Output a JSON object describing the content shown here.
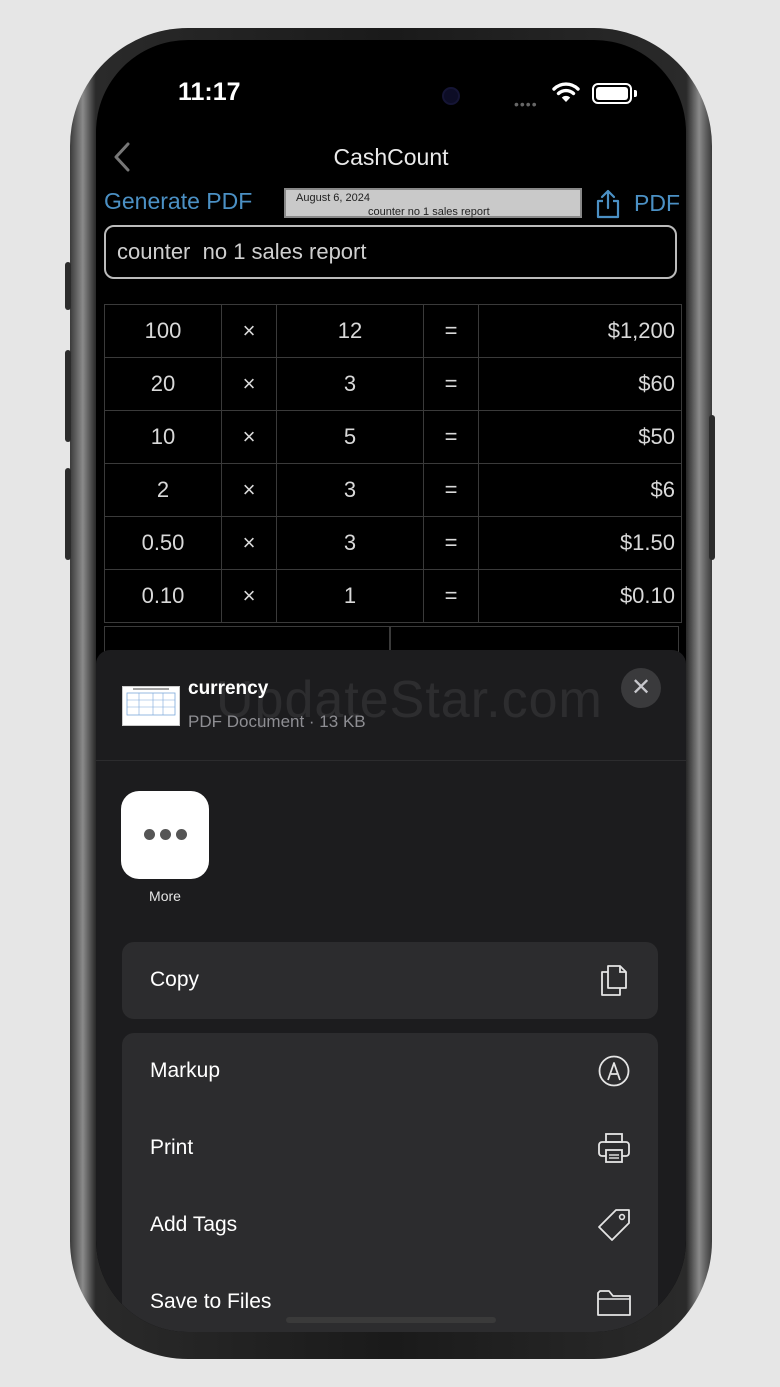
{
  "status": {
    "time": "11:17"
  },
  "nav": {
    "title": "CashCount"
  },
  "toolbar": {
    "generate_label": "Generate PDF",
    "pdf_label": "PDF",
    "preview_date": "August 6, 2024",
    "preview_title": "counter  no 1 sales report"
  },
  "report_title": "counter  no 1 sales report",
  "rows": [
    {
      "denomination": "100",
      "op": "×",
      "count": "12",
      "eq": "=",
      "total": "$1,200"
    },
    {
      "denomination": "20",
      "op": "×",
      "count": "3",
      "eq": "=",
      "total": "$60"
    },
    {
      "denomination": "10",
      "op": "×",
      "count": "5",
      "eq": "=",
      "total": "$50"
    },
    {
      "denomination": "2",
      "op": "×",
      "count": "3",
      "eq": "=",
      "total": "$6"
    },
    {
      "denomination": "0.50",
      "op": "×",
      "count": "3",
      "eq": "=",
      "total": "$1.50"
    },
    {
      "denomination": "0.10",
      "op": "×",
      "count": "1",
      "eq": "=",
      "total": "$0.10"
    }
  ],
  "share_sheet": {
    "file_name": "currency",
    "file_meta": "PDF Document · 13 KB",
    "watermark": "UpdateStar.com",
    "close_symbol": "✕",
    "more_label": "More",
    "actions": [
      {
        "label": "Copy",
        "icon": "copy-icon"
      },
      {
        "label": "Markup",
        "icon": "markup-icon"
      },
      {
        "label": "Print",
        "icon": "print-icon"
      },
      {
        "label": "Add Tags",
        "icon": "tag-icon"
      },
      {
        "label": "Save to Files",
        "icon": "folder-icon"
      }
    ]
  },
  "colors": {
    "accent": "#4b90c4",
    "sheet_bg": "#1c1c1e",
    "action_bg": "#2c2c2e"
  }
}
